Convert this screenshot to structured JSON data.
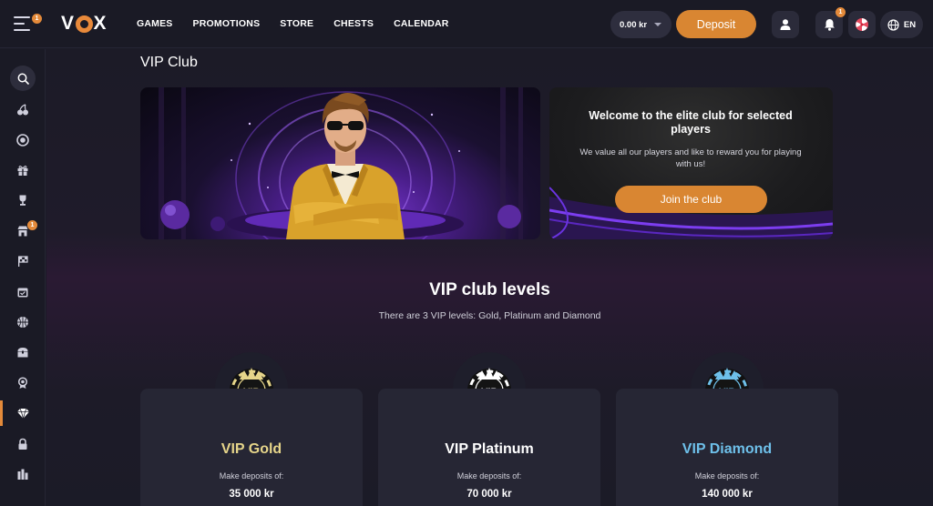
{
  "header": {
    "menu_badge": "1",
    "logo_text": {
      "left": "V",
      "right": "X"
    },
    "nav": [
      "GAMES",
      "PROMOTIONS",
      "STORE",
      "CHESTS",
      "CALENDAR"
    ],
    "balance": "0.00 kr",
    "deposit_label": "Deposit",
    "notifications_badge": "1",
    "language": "EN"
  },
  "sidebar": {
    "items": [
      "search",
      "fruit-slots",
      "live-casino",
      "gift",
      "trophy",
      "store",
      "tournaments",
      "calendar",
      "sports",
      "chests",
      "award",
      "vip",
      "lock",
      "stats"
    ],
    "store_badge": "1",
    "active": "vip"
  },
  "main": {
    "page_title": "VIP Club",
    "welcome": {
      "title": "Welcome to the elite club for selected players",
      "text": "We value all our players and like to reward you for playing with us!",
      "button": "Join the club"
    },
    "levels_title": "VIP club levels",
    "levels_subtitle": "There are 3 VIP levels: Gold, Platinum and Diamond",
    "levels": [
      {
        "name": "VIP Gold",
        "label": "Make deposits of:",
        "amount": "35 000 kr",
        "chip_text": "VIP",
        "color": "#e6d58a"
      },
      {
        "name": "VIP Platinum",
        "label": "Make deposits of:",
        "amount": "70 000 kr",
        "chip_text": "VIP",
        "color": "#ffffff"
      },
      {
        "name": "VIP Diamond",
        "label": "Make deposits of:",
        "amount": "140 000 kr",
        "chip_text": "VIP",
        "color": "#6ec0ea"
      }
    ]
  },
  "colors": {
    "accent": "#d98632",
    "background": "#1b1b27",
    "card": "#262634"
  }
}
